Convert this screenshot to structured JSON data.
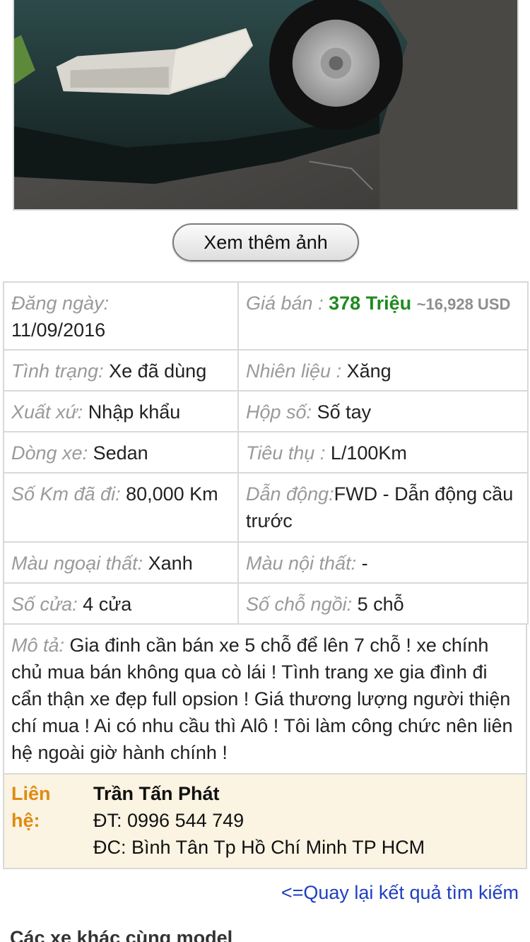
{
  "gallery": {
    "more_photos_label": "Xem thêm ảnh"
  },
  "specs": {
    "posted": {
      "label": "Đăng ngày:",
      "value": "11/09/2016"
    },
    "price": {
      "label": "Giá bán :",
      "value": "378 Triệu",
      "usd": "~16,928 USD"
    },
    "condition": {
      "label": "Tình trạng:",
      "value": "Xe đã dùng"
    },
    "fuel": {
      "label": "Nhiên liệu :",
      "value": "Xăng"
    },
    "origin": {
      "label": "Xuất xứ:",
      "value": "Nhập khẩu"
    },
    "gearbox": {
      "label": "Hộp số:",
      "value": "Số tay"
    },
    "body_type": {
      "label": "Dòng xe:",
      "value": "Sedan"
    },
    "consumption": {
      "label": "Tiêu thụ :",
      "value": "L/100Km"
    },
    "mileage": {
      "label": "Số Km đã đi:",
      "value": "80,000 Km"
    },
    "drive": {
      "label": "Dẫn động:",
      "value": "FWD - Dẫn động cầu trước"
    },
    "exterior_color": {
      "label": "Màu ngoại thất:",
      "value": "Xanh"
    },
    "interior_color": {
      "label": "Màu nội thất:",
      "value": "-"
    },
    "doors": {
      "label": "Số cửa:",
      "value": "4 cửa"
    },
    "seats": {
      "label": "Số chỗ ngồi:",
      "value": "5 chỗ"
    }
  },
  "description": {
    "label": "Mô tả:",
    "text": "Gia đinh cần bán xe 5 chỗ để lên 7 chỗ ! xe chính chủ mua bán không qua cò lái ! Tình trang xe gia đình đi cẩn thận xe đẹp full opsion ! Giá thương lượng người thiện chí mua ! Ai có nhu cầu thì Alô ! Tôi làm công chức nên liên hệ ngoài giờ hành chính !"
  },
  "contact": {
    "label": "Liên hệ:",
    "name": "Trần Tấn Phát",
    "phone": "ĐT: 0996 544 749",
    "address": "ĐC: Bình Tân Tp Hồ Chí Minh TP HCM"
  },
  "back_link": "<=Quay lại kết quả tìm kiếm",
  "other_models_title": "Các xe khác cùng model",
  "colors": {
    "price_green": "#1f8b1f",
    "label_gray": "#9a9a9a",
    "contact_orange": "#e08a14",
    "link_blue": "#1f3fbf",
    "contact_bg": "#fbf4e3"
  }
}
